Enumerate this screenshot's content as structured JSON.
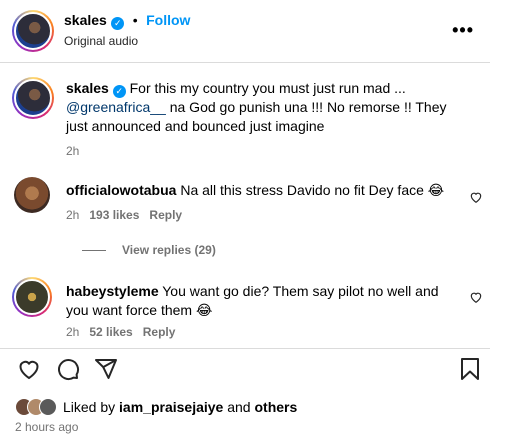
{
  "post": {
    "username": "skales",
    "separator": "•",
    "follow_label": "Follow",
    "audio_label": "Original audio",
    "more_label": "•••"
  },
  "caption": {
    "username": "skales",
    "text_before": " For this my country you must just run mad ...",
    "mention": "@greenafrica__",
    "text_after": " na God go punish una !!! No remorse !! They just announced and bounced just imagine",
    "time": "2h"
  },
  "comments": [
    {
      "username": "officialowotabua",
      "text": " Na all this stress Davido no fit Dey face 😂",
      "time": "2h",
      "likes": "193 likes",
      "reply_label": "Reply",
      "view_replies": "View replies (29)"
    },
    {
      "username": "habeystyleme",
      "text": " You want go die? Them say pilot no well and you want force them 😂",
      "time": "2h",
      "likes": "52 likes",
      "reply_label": "Reply"
    }
  ],
  "footer": {
    "liked_by_prefix": "Liked by ",
    "liked_by_user": "iam_praisejaiye",
    "liked_by_join": " and ",
    "liked_by_others": "others",
    "time_ago": "2 hours ago"
  },
  "icons": {
    "heart": "heart-icon",
    "comment": "comment-icon",
    "share": "paper-plane-icon",
    "save": "bookmark-icon",
    "verified": "verified-badge-icon",
    "more": "more-options-icon"
  },
  "colors": {
    "accent": "#0095f6",
    "muted": "#737373",
    "mention": "#00376b",
    "divider": "#dbdbdb"
  }
}
